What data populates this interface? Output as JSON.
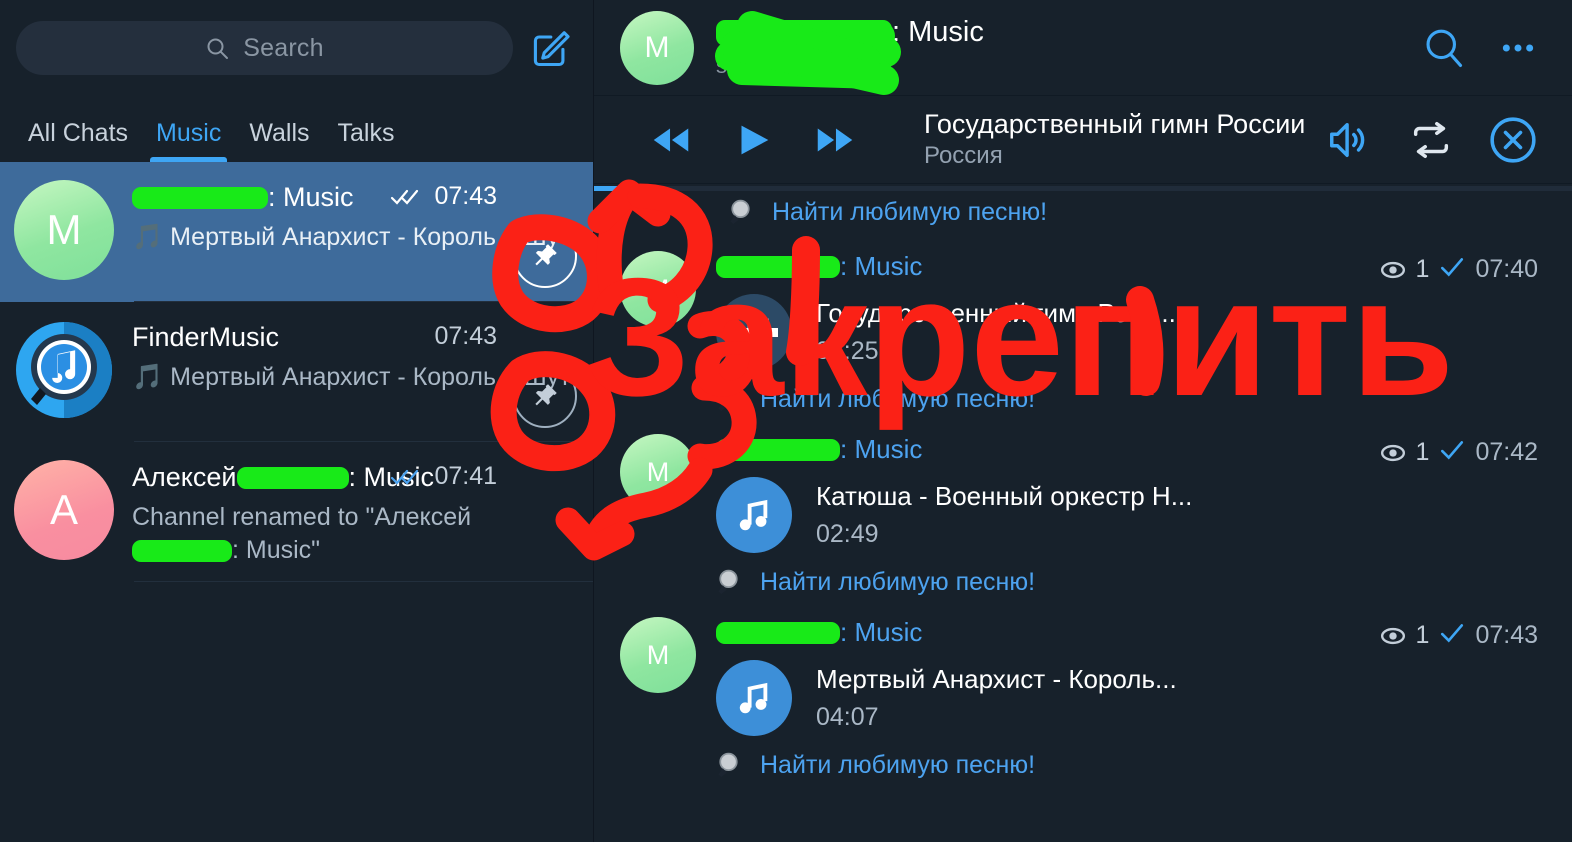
{
  "sidebar": {
    "search": {
      "placeholder": "Search",
      "icon": "search-icon"
    },
    "compose_icon": "compose-icon",
    "tabs": [
      {
        "label": "All Chats",
        "active": false
      },
      {
        "label": "Music",
        "active": true
      },
      {
        "label": "Walls",
        "active": false
      },
      {
        "label": "Talks",
        "active": false
      }
    ],
    "chats": [
      {
        "avatar_letter": "M",
        "title_redacted": true,
        "title_suffix": ": Music",
        "preview": "🎵 Мертвый Анархист - Король и Шут",
        "time": "07:43",
        "read_status": "double-check",
        "selected": true,
        "pin_icon": "pin-icon"
      },
      {
        "avatar_letter": "",
        "title_redacted": false,
        "title": "FinderMusic",
        "preview": "🎵 Мертвый Анархист - Король и Шут",
        "time": "07:43",
        "read_status": "none",
        "selected": false,
        "pin_icon": "pin-icon"
      },
      {
        "avatar_letter": "A",
        "title_redacted": true,
        "title_prefix": "Алексей ",
        "title_suffix": ": Music",
        "preview": "Channel renamed to \"Алексей ████: Music\"",
        "preview_line1": "Channel renamed to \"Алексей",
        "preview_line2": ": Music\"",
        "time": "07:41",
        "read_status": "double-check",
        "selected": false
      }
    ]
  },
  "chat_header": {
    "avatar_letter": "M",
    "title_suffix": ": Music",
    "subtitle": "subscriber",
    "search_icon": "search-icon",
    "menu_icon": "more-options-icon"
  },
  "player": {
    "prev_icon": "rewind-icon",
    "play_icon": "play-icon",
    "next_icon": "fast-forward-icon",
    "track": "Государственный гимн России",
    "artist": "Россия",
    "volume_icon": "volume-icon",
    "repeat_icon": "repeat-icon",
    "close_icon": "close-circle-icon"
  },
  "messages": {
    "top_partial_link": "🔍 Найти любимую песню!",
    "link_label": "Найти любимую песню!",
    "items": [
      {
        "avatar_letter": "M",
        "author_suffix": ": Music",
        "song": "Государственный гимн Росс...",
        "duration": "03:25",
        "views": "1",
        "time": "07:40",
        "playing": true,
        "link": "Найти любимую песню!"
      },
      {
        "avatar_letter": "M",
        "author_suffix": ": Music",
        "song": "Катюша - Военный оркестр Н...",
        "duration": "02:49",
        "views": "1",
        "time": "07:42",
        "playing": false,
        "link": "Найти любимую песню!"
      },
      {
        "avatar_letter": "M",
        "author_suffix": ": Music",
        "song": "Мертвый Анархист - Король...",
        "duration": "04:07",
        "views": "1",
        "time": "07:43",
        "playing": false,
        "link": "Найти любимую песню!"
      }
    ]
  },
  "annotation": {
    "text": "Закрепить",
    "color": "#fb2116",
    "redaction_color": "#18ea18"
  },
  "theme": {
    "background": "#17212b",
    "selected_row": "#3e6b9b",
    "accent": "#4da3f0",
    "search_bg": "#242f3d",
    "muted_text": "#8a96a3"
  }
}
